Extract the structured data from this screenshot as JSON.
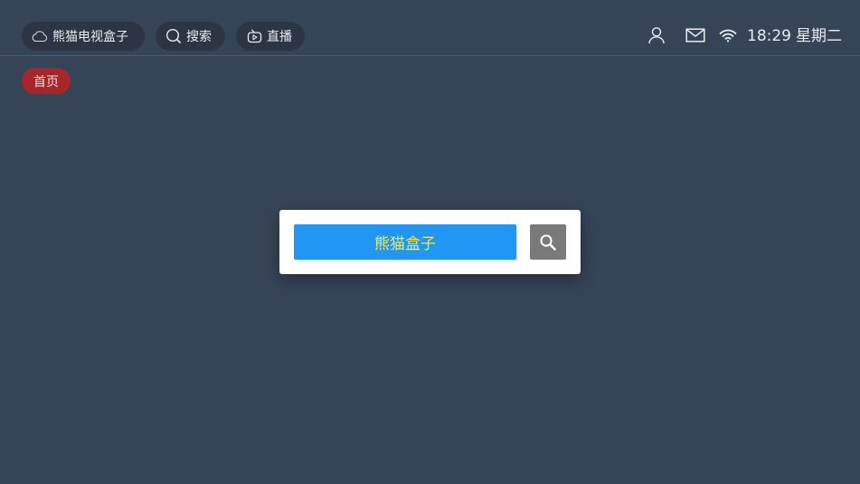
{
  "header": {
    "brand_label": "熊猫电视盒子",
    "search_label": "搜索",
    "live_label": "直播",
    "brand_icon": "cloud-icon",
    "search_icon": "search-icon",
    "live_icon": "tv-icon"
  },
  "status": {
    "user_icon": "user-icon",
    "mail_icon": "mail-icon",
    "wifi_icon": "wifi-icon",
    "time": "18:29",
    "weekday": "星期二"
  },
  "nav": {
    "home_label": "首页"
  },
  "dialog": {
    "search_value": "熊猫盒子",
    "search_button_icon": "search-icon"
  },
  "colors": {
    "background": "#364457",
    "pill_background": "#2b3544",
    "home_tab": "#a7262a",
    "search_field": "#2196f3",
    "search_text": "#ffeb3b",
    "search_button": "#7a7a7a"
  }
}
